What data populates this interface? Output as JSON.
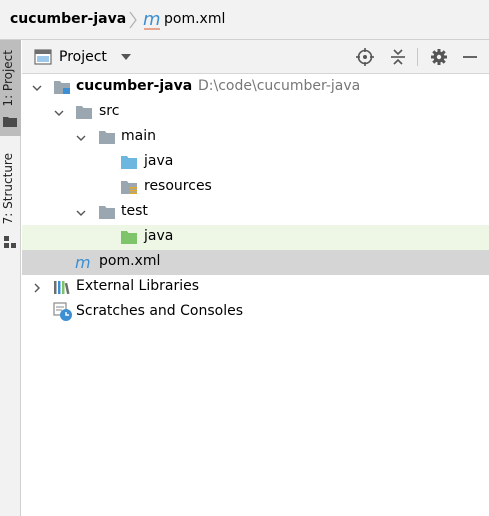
{
  "breadcrumb": {
    "project": "cucumber-java",
    "file": "pom.xml",
    "file_icon": "maven-m-icon"
  },
  "tool_strip": {
    "project_tab": "1: Project",
    "structure_tab": "7: Structure"
  },
  "panel": {
    "title": "Project",
    "actions": [
      "locate-icon",
      "collapse-all-icon",
      "gear-icon",
      "minimize-icon"
    ]
  },
  "tree": {
    "root": {
      "name": "cucumber-java",
      "path": "D:\\code\\cucumber-java"
    },
    "src": "src",
    "main": "main",
    "main_java": "java",
    "resources": "resources",
    "test": "test",
    "test_java": "java",
    "pom": "pom.xml",
    "external_libraries": "External Libraries",
    "scratches": "Scratches and Consoles"
  },
  "colors": {
    "folder_gray": "#9aa7b0",
    "folder_blue": "#6cb7e0",
    "folder_green": "#7ec46a",
    "maven_blue": "#3d8fd3",
    "selection_gray": "#d5d5d5",
    "selection_green": "#eef6e6"
  }
}
